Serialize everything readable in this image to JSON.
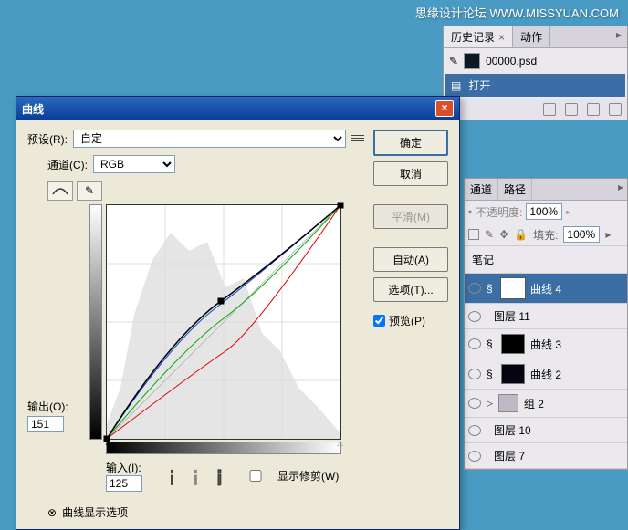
{
  "watermark": "思缘设计论坛 WWW.MISSYUAN.COM",
  "history": {
    "tabs": [
      "历史记录",
      "动作"
    ],
    "filename": "00000.psd",
    "open_label": "打开"
  },
  "layers": {
    "tabs": [
      "通道",
      "路径"
    ],
    "opacity_label": "不透明度:",
    "opacity_value": "100%",
    "fill_label": "填充:",
    "fill_value": "100%",
    "lock_dir_label": "",
    "biji": "笔记",
    "items": [
      {
        "name": "曲线 4",
        "thumb": "white"
      },
      {
        "name": "图层 11",
        "thumb": "none"
      },
      {
        "name": "曲线 3",
        "thumb": "dark"
      },
      {
        "name": "曲线 2",
        "thumb": "darkred"
      },
      {
        "name": "组 2",
        "thumb": "folder"
      },
      {
        "name": "图层 10",
        "thumb": "none"
      },
      {
        "name": "图层 7",
        "thumb": "none"
      }
    ]
  },
  "dialog": {
    "title": "曲线",
    "preset_label": "预设(R):",
    "preset_value": "自定",
    "channel_label": "通道(C):",
    "channel_value": "RGB",
    "output_label": "输出(O):",
    "output_value": "151",
    "input_label": "输入(I):",
    "input_value": "125",
    "show_clip_label": "显示修剪(W)",
    "curve_options_label": "曲线显示选项",
    "buttons": {
      "ok": "确定",
      "cancel": "取消",
      "smooth": "平滑(M)",
      "auto": "自动(A)",
      "options": "选项(T)...",
      "preview": "预览(P)"
    }
  },
  "chart_data": {
    "type": "line",
    "title": "曲线",
    "xlabel": "输入",
    "ylabel": "输出",
    "xlim": [
      0,
      255
    ],
    "ylim": [
      0,
      255
    ],
    "series": [
      {
        "name": "RGB",
        "color": "#000",
        "points": [
          [
            0,
            0
          ],
          [
            125,
            151
          ],
          [
            255,
            255
          ]
        ]
      },
      {
        "name": "R",
        "color": "#d00",
        "points": [
          [
            0,
            0
          ],
          [
            130,
            95
          ],
          [
            255,
            255
          ]
        ]
      },
      {
        "name": "G",
        "color": "#0a0",
        "points": [
          [
            0,
            0
          ],
          [
            128,
            132
          ],
          [
            255,
            255
          ]
        ]
      },
      {
        "name": "B",
        "color": "#14c",
        "points": [
          [
            0,
            0
          ],
          [
            120,
            144
          ],
          [
            255,
            255
          ]
        ]
      }
    ],
    "selected_point": {
      "input": 125,
      "output": 151
    }
  }
}
